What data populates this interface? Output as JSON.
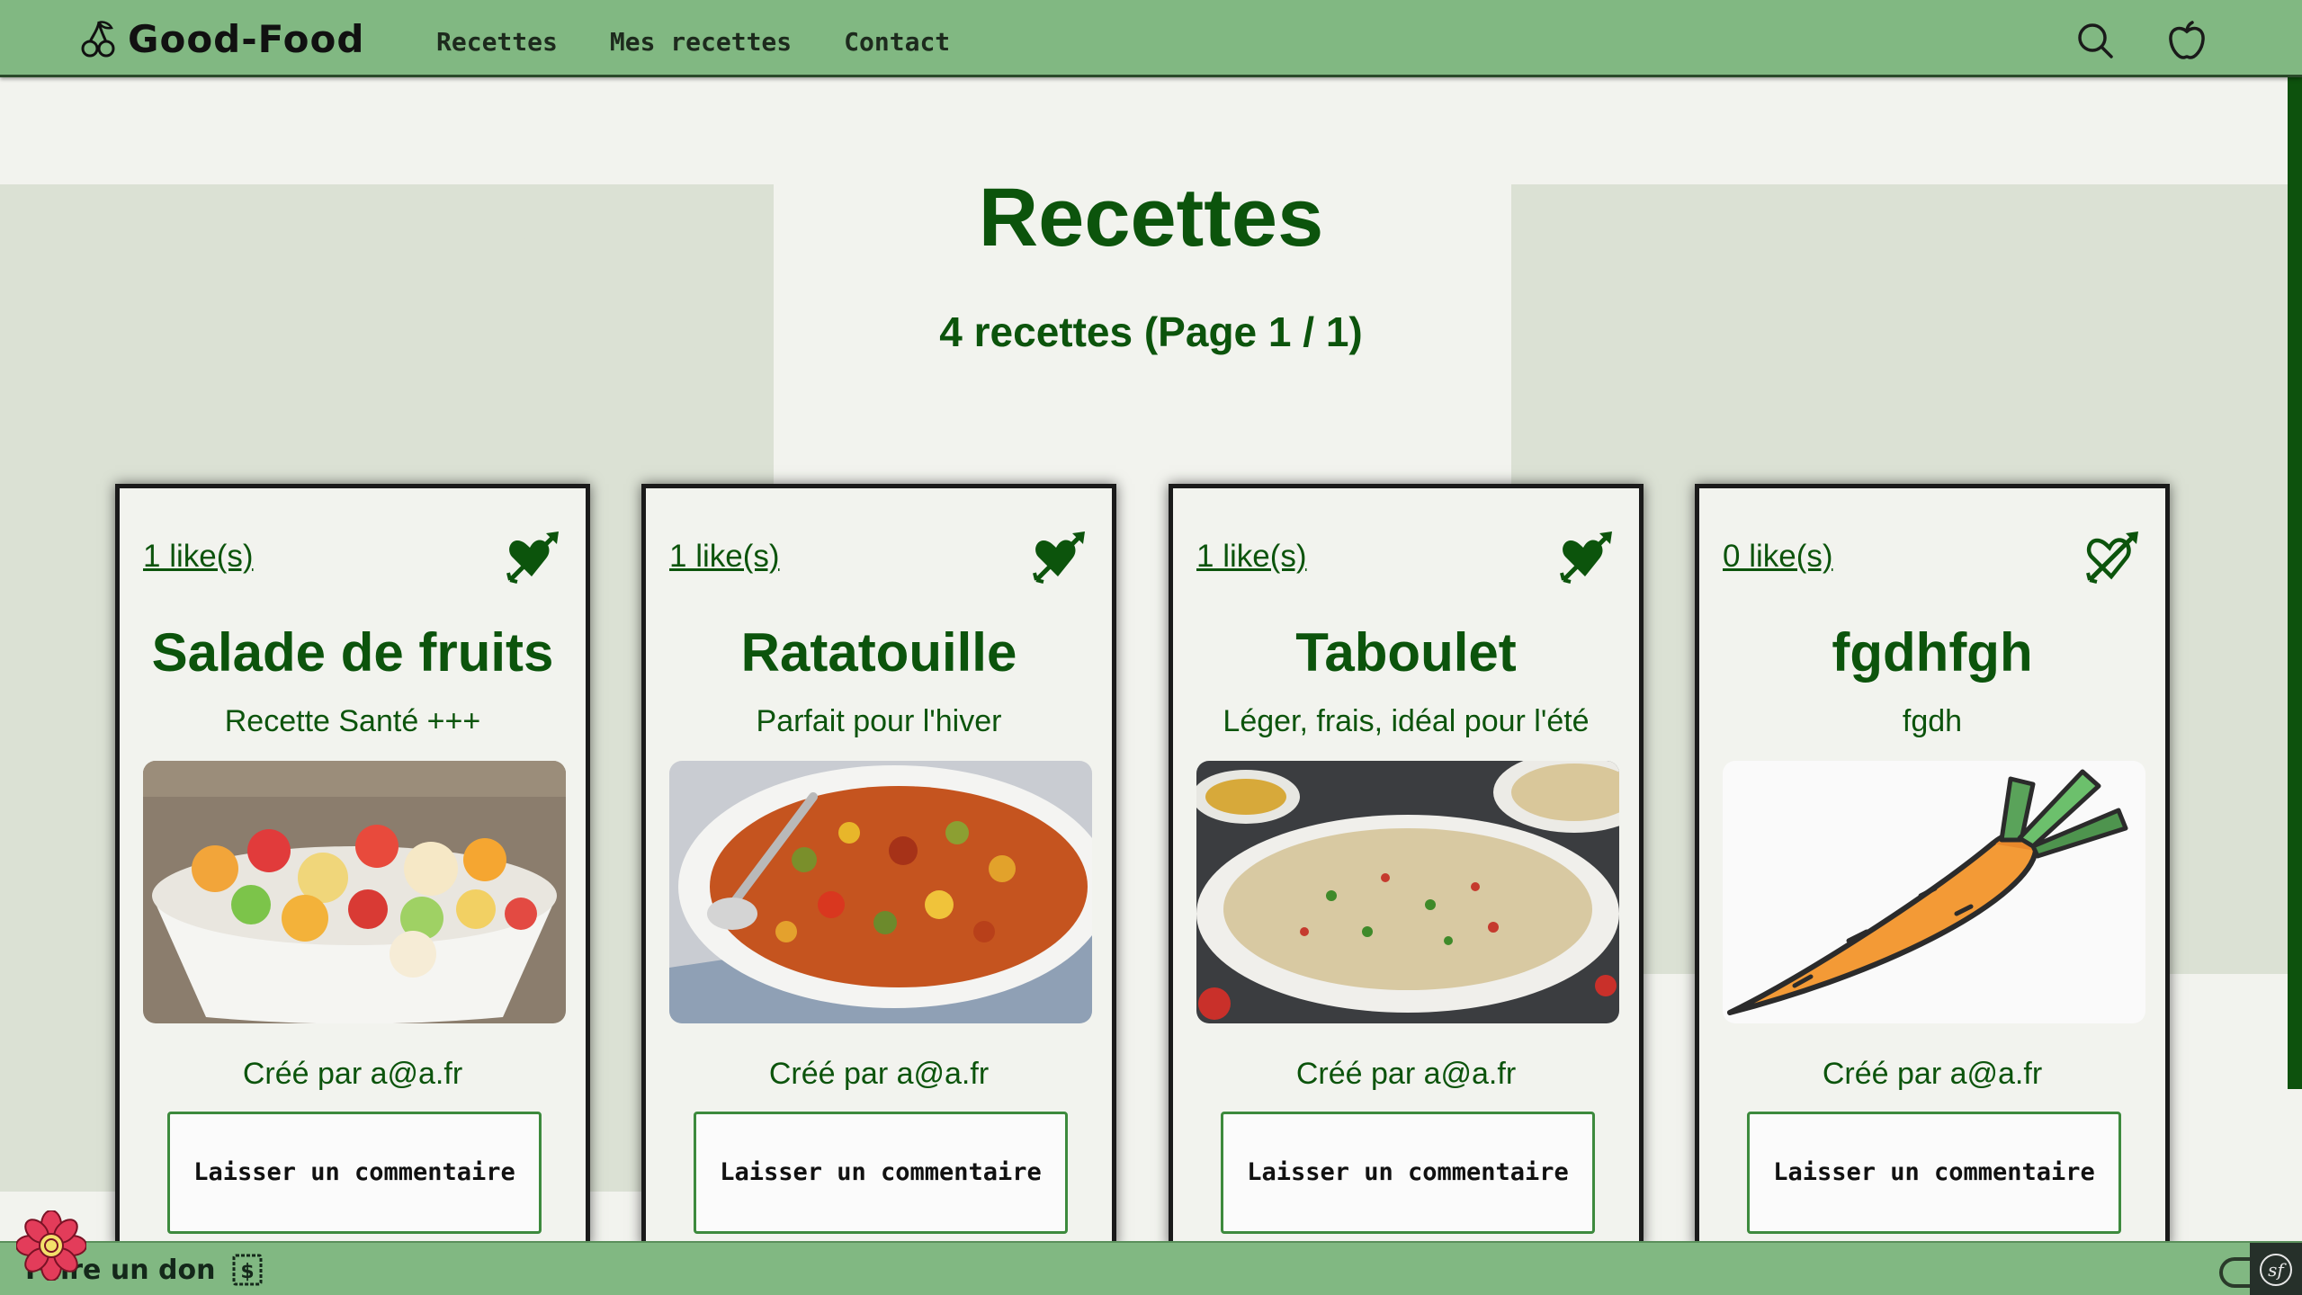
{
  "header": {
    "brand": "Good-Food",
    "nav": [
      "Recettes",
      "Mes recettes",
      "Contact"
    ],
    "icons": [
      "search-icon",
      "apple-icon"
    ]
  },
  "hero": {
    "title": "Recettes",
    "count_text": "4 recettes (Page 1 / 1)"
  },
  "recipes": [
    {
      "likes": "1 like(s)",
      "liked": true,
      "title": "Salade de fruits",
      "description": "Recette Santé +++",
      "author": "Créé par a@a.fr",
      "button": "Laisser un commentaire",
      "image": "fruit-salad"
    },
    {
      "likes": "1 like(s)",
      "liked": true,
      "title": "Ratatouille",
      "description": "Parfait pour l'hiver",
      "author": "Créé par a@a.fr",
      "button": "Laisser un commentaire",
      "image": "ratatouille"
    },
    {
      "likes": "1 like(s)",
      "liked": true,
      "title": "Taboulet",
      "description": "Léger, frais, idéal pour l'été",
      "author": "Créé par a@a.fr",
      "button": "Laisser un commentaire",
      "image": "taboule"
    },
    {
      "likes": "0 like(s)",
      "liked": false,
      "title": "fgdhfgh",
      "description": "fgdh",
      "author": "Créé par a@a.fr",
      "button": "Laisser un commentaire",
      "image": "carrot"
    }
  ],
  "footer": {
    "donate": "Faire un don",
    "icons": [
      "dollar-icon",
      "flower-icon",
      "symfony-icon"
    ]
  },
  "colors": {
    "header_bg": "#81b882",
    "text_green": "#0c540c",
    "page_bg": "#f2f3ee",
    "arc_bg": "#dbe1d4"
  }
}
